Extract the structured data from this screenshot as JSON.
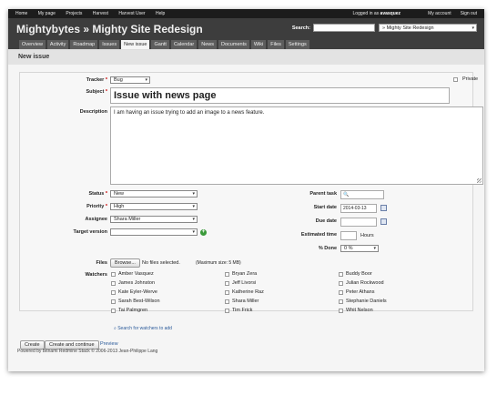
{
  "topbar": {
    "menu": [
      "Home",
      "My page",
      "Projects",
      "Harvest",
      "Harvest User",
      "Help"
    ],
    "logged_in_prefix": "Logged in as",
    "user": "avasquez",
    "my_account": "My account",
    "sign_out": "Sign out"
  },
  "header": {
    "title": "Mightybytes » Mighty Site Redesign",
    "search_label": "Search:",
    "search_value": "",
    "jump_value": "» Mighty Site Redesign"
  },
  "tabs": [
    "Overview",
    "Activity",
    "Roadmap",
    "Issues",
    "New issue",
    "Gantt",
    "Calendar",
    "News",
    "Documents",
    "Wiki",
    "Files",
    "Settings"
  ],
  "active_tab": "New issue",
  "page": {
    "title": "New issue"
  },
  "form": {
    "tracker_label": "Tracker",
    "tracker_value": "Bug",
    "private_label": "Private",
    "subject_label": "Subject",
    "subject_value": "Issue with news page",
    "description_label": "Description",
    "description_value": "I am having an issue trying to add an image to a news feature.",
    "status_label": "Status",
    "status_value": "New",
    "priority_label": "Priority",
    "priority_value": "High",
    "assignee_label": "Assignee",
    "assignee_value": "Shara Miller",
    "target_version_label": "Target version",
    "target_version_value": "",
    "parent_task_label": "Parent task",
    "start_date_label": "Start date",
    "start_date_value": "2014-03-13",
    "due_date_label": "Due date",
    "due_date_value": "",
    "estimated_time_label": "Estimated time",
    "hours_label": "Hours",
    "done_label": "% Done",
    "done_value": "0 %",
    "files_label": "Files",
    "browse_label": "Browse...",
    "no_files": "No files selected.",
    "max_size": "(Maximum size: 5 MB)",
    "watchers_label": "Watchers",
    "watchers": [
      [
        "Amber Vasquez",
        "Bryan Zera",
        "Buddy Boor"
      ],
      [
        "James Johnston",
        "Jeff Livorsi",
        "Julian Rockwood"
      ],
      [
        "Kate Eyler-Werve",
        "Katherine Raz",
        "Peter Athans"
      ],
      [
        "Sarah Best-Wilson",
        "Shara Miller",
        "Stephanie Daniels"
      ],
      [
        "Tai Palmgren",
        "Tim Frick",
        "Whit Nelson"
      ]
    ],
    "search_watchers": "Search for watchers to add"
  },
  "buttons": {
    "create": "Create",
    "create_continue": "Create and continue",
    "preview": "Preview"
  },
  "footer": "Powered by Bitnami Redmine Stack © 2006-2013 Jean-Philippe Lang"
}
